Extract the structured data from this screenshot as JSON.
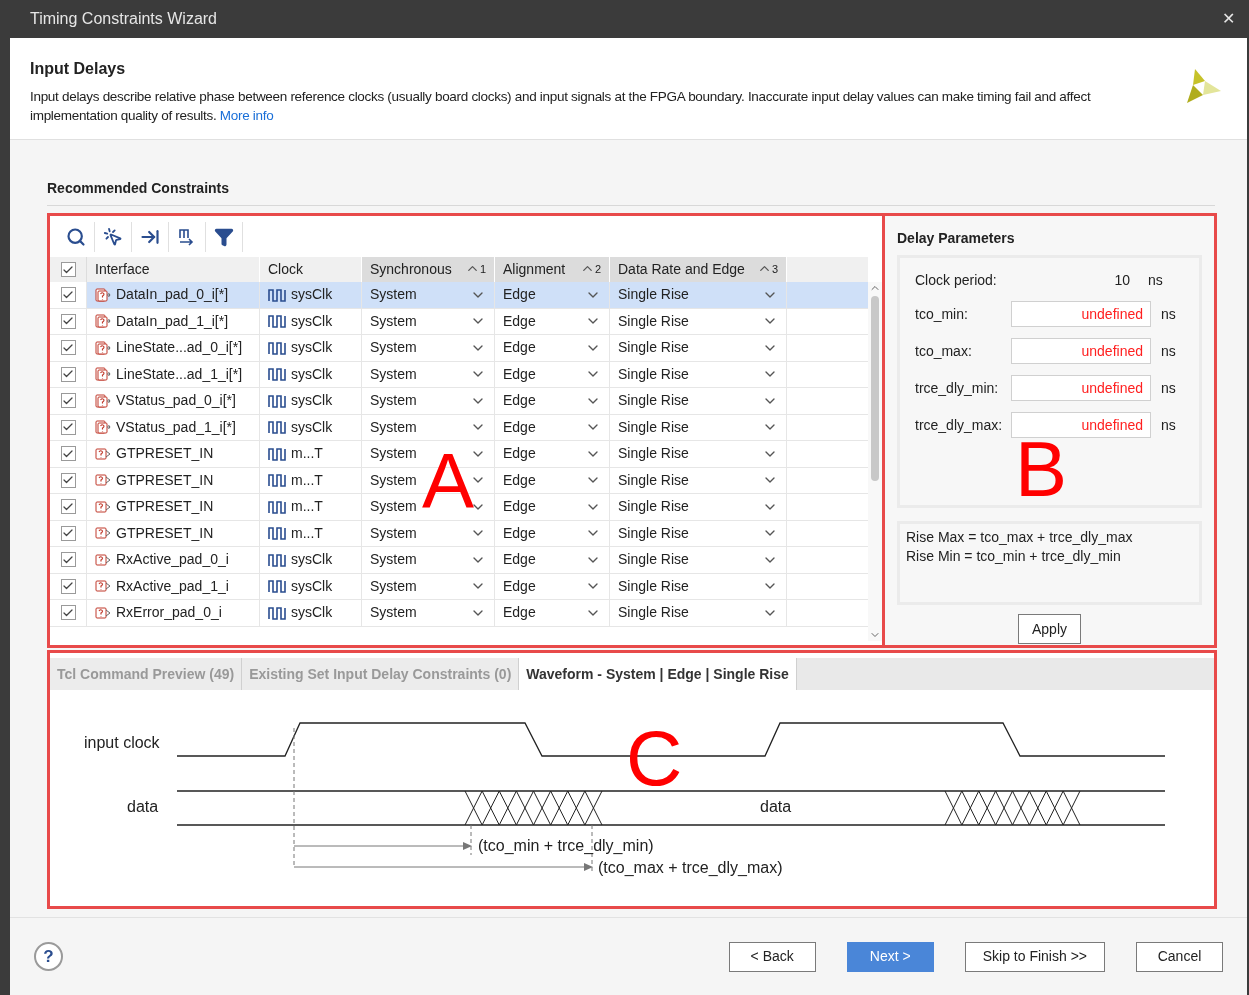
{
  "window": {
    "title": "Timing Constraints Wizard",
    "close": "✕"
  },
  "header": {
    "title": "Input Delays",
    "description": "Input delays describe relative phase between reference clocks (usually board clocks) and input signals at the FPGA boundary. Inaccurate input delay values can make timing fail and affect implementation quality of results.",
    "link": "More info"
  },
  "section_title": "Recommended Constraints",
  "table": {
    "header_checked": true,
    "columns": [
      {
        "label": "Interface",
        "sorted": false
      },
      {
        "label": "Clock",
        "sorted": false
      },
      {
        "label": "Synchronous",
        "sorted": true,
        "order": "1"
      },
      {
        "label": "Alignment",
        "sorted": true,
        "order": "2"
      },
      {
        "label": "Data Rate and Edge",
        "sorted": true,
        "order": "3"
      }
    ],
    "rows": [
      {
        "checked": true,
        "selected": true,
        "kind": "bus",
        "interface": "DataIn_pad_0_i[*]",
        "clock": "sysClk",
        "synchronous": "System",
        "alignment": "Edge",
        "data_rate": "Single Rise"
      },
      {
        "checked": true,
        "selected": false,
        "kind": "bus",
        "interface": "DataIn_pad_1_i[*]",
        "clock": "sysClk",
        "synchronous": "System",
        "alignment": "Edge",
        "data_rate": "Single Rise"
      },
      {
        "checked": true,
        "selected": false,
        "kind": "bus",
        "interface": "LineState...ad_0_i[*]",
        "clock": "sysClk",
        "synchronous": "System",
        "alignment": "Edge",
        "data_rate": "Single Rise"
      },
      {
        "checked": true,
        "selected": false,
        "kind": "bus",
        "interface": "LineState...ad_1_i[*]",
        "clock": "sysClk",
        "synchronous": "System",
        "alignment": "Edge",
        "data_rate": "Single Rise"
      },
      {
        "checked": true,
        "selected": false,
        "kind": "bus",
        "interface": "VStatus_pad_0_i[*]",
        "clock": "sysClk",
        "synchronous": "System",
        "alignment": "Edge",
        "data_rate": "Single Rise"
      },
      {
        "checked": true,
        "selected": false,
        "kind": "bus",
        "interface": "VStatus_pad_1_i[*]",
        "clock": "sysClk",
        "synchronous": "System",
        "alignment": "Edge",
        "data_rate": "Single Rise"
      },
      {
        "checked": true,
        "selected": false,
        "kind": "port",
        "interface": "GTPRESET_IN",
        "clock": "m...T",
        "synchronous": "System",
        "alignment": "Edge",
        "data_rate": "Single Rise"
      },
      {
        "checked": true,
        "selected": false,
        "kind": "port",
        "interface": "GTPRESET_IN",
        "clock": "m...T",
        "synchronous": "System",
        "alignment": "Edge",
        "data_rate": "Single Rise"
      },
      {
        "checked": true,
        "selected": false,
        "kind": "port",
        "interface": "GTPRESET_IN",
        "clock": "m...T",
        "synchronous": "System",
        "alignment": "Edge",
        "data_rate": "Single Rise"
      },
      {
        "checked": true,
        "selected": false,
        "kind": "port",
        "interface": "GTPRESET_IN",
        "clock": "m...T",
        "synchronous": "System",
        "alignment": "Edge",
        "data_rate": "Single Rise"
      },
      {
        "checked": true,
        "selected": false,
        "kind": "port",
        "interface": "RxActive_pad_0_i",
        "clock": "sysClk",
        "synchronous": "System",
        "alignment": "Edge",
        "data_rate": "Single Rise"
      },
      {
        "checked": true,
        "selected": false,
        "kind": "port",
        "interface": "RxActive_pad_1_i",
        "clock": "sysClk",
        "synchronous": "System",
        "alignment": "Edge",
        "data_rate": "Single Rise"
      },
      {
        "checked": true,
        "selected": false,
        "kind": "port",
        "interface": "RxError_pad_0_i",
        "clock": "sysClk",
        "synchronous": "System",
        "alignment": "Edge",
        "data_rate": "Single Rise"
      }
    ]
  },
  "delay_parameters": {
    "title": "Delay Parameters",
    "clock_period": {
      "label": "Clock period:",
      "value": "10",
      "unit": "ns"
    },
    "fields": [
      {
        "label": "tco_min:",
        "value": "undefined",
        "unit": "ns"
      },
      {
        "label": "tco_max:",
        "value": "undefined",
        "unit": "ns"
      },
      {
        "label": "trce_dly_min:",
        "value": "undefined",
        "unit": "ns"
      },
      {
        "label": "trce_dly_max:",
        "value": "undefined",
        "unit": "ns"
      }
    ],
    "formulas": [
      "Rise Max = tco_max + trce_dly_max",
      "Rise Min = tco_min + trce_dly_min"
    ],
    "apply": "Apply"
  },
  "bottom_tabs": [
    {
      "label": "Tcl Command Preview (49)",
      "selected": false
    },
    {
      "label": "Existing Set Input Delay Constraints (0)",
      "selected": false
    },
    {
      "label": "Waveform - System | Edge | Single Rise",
      "selected": true
    }
  ],
  "waveform": {
    "clock_label": "input clock",
    "data_label": "data",
    "data_text": "data",
    "min_label": "(tco_min + trce_dly_min)",
    "max_label": "(tco_max + trce_dly_max)"
  },
  "annotations": [
    "A",
    "B",
    "C"
  ],
  "footer": {
    "help": "?",
    "buttons": [
      {
        "label": "< Back",
        "kind": "default"
      },
      {
        "label": "Next >",
        "kind": "primary"
      },
      {
        "label": "Skip to Finish >>",
        "kind": "default"
      },
      {
        "label": "Cancel",
        "kind": "default"
      }
    ]
  }
}
